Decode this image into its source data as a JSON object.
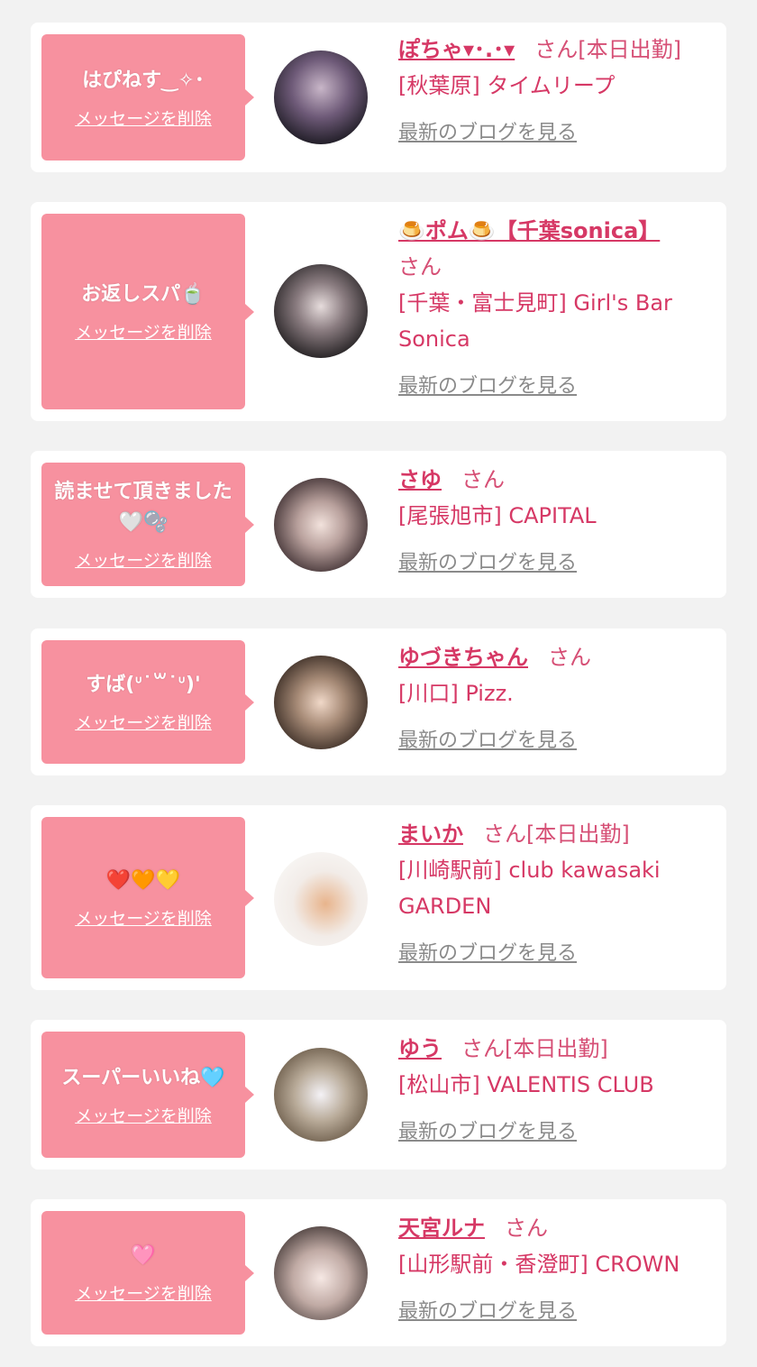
{
  "messages": [
    {
      "message": "はぴねす‿✧･",
      "delete_label": "メッセージを削除",
      "name": "ぽちゃ▾･.･▾",
      "suffix": "さん[本日出勤]",
      "shop": "[秋葉原] タイムリープ",
      "blog_label": "最新のブログを見る"
    },
    {
      "message": "お返しスパ🍵",
      "delete_label": "メッセージを削除",
      "name": "🍮ポム🍮【千葉sonica】",
      "suffix": "さん",
      "shop": "[千葉・富士見町] Girl's Bar Sonica",
      "blog_label": "最新のブログを見る"
    },
    {
      "message": "読ませて頂きました🤍🫧",
      "delete_label": "メッセージを削除",
      "name": "さゆ",
      "suffix": "さん",
      "shop": "[尾張旭市] CAPITAL",
      "blog_label": "最新のブログを見る"
    },
    {
      "message": "すば(ᐡ˙꒳˙ᐡ)'",
      "delete_label": "メッセージを削除",
      "name": "ゆづきちゃん",
      "suffix": "さん",
      "shop": "[川口] Pizz.",
      "blog_label": "最新のブログを見る"
    },
    {
      "message": "❤️🧡💛",
      "delete_label": "メッセージを削除",
      "name": "まいか",
      "suffix": "さん[本日出勤]",
      "shop": "[川崎駅前] club kawasaki GARDEN",
      "blog_label": "最新のブログを見る"
    },
    {
      "message": "スーパーいいね🩵",
      "delete_label": "メッセージを削除",
      "name": "ゆう",
      "suffix": "さん[本日出勤]",
      "shop": "[松山市] VALENTIS CLUB",
      "blog_label": "最新のブログを見る"
    },
    {
      "message": "🩷",
      "delete_label": "メッセージを削除",
      "name": "天宮ルナ",
      "suffix": "さん",
      "shop": "[山形駅前・香澄町] CROWN",
      "blog_label": "最新のブログを見る"
    }
  ]
}
